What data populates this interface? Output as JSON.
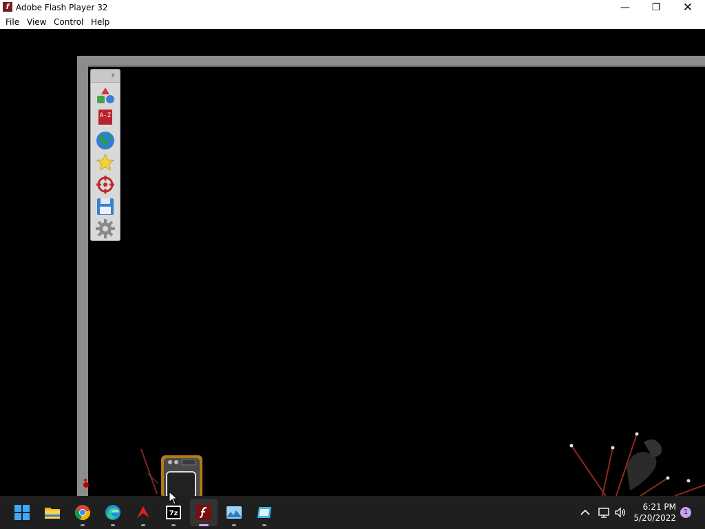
{
  "window": {
    "title": "Adobe Flash Player 32",
    "app_icon_glyph": "f",
    "controls": {
      "minimize": "—",
      "maximize": "❐",
      "close": "✕"
    }
  },
  "menu": {
    "items": [
      "File",
      "View",
      "Control",
      "Help"
    ]
  },
  "toolbar": {
    "collapse_glyph": "›",
    "tools": [
      {
        "name": "shapes-icon"
      },
      {
        "name": "a-z-icon",
        "label": "A-Z"
      },
      {
        "name": "globe-icon"
      },
      {
        "name": "star-icon"
      },
      {
        "name": "target-icon"
      },
      {
        "name": "save-icon"
      },
      {
        "name": "gear-icon"
      }
    ]
  },
  "taskbar": {
    "apps": [
      {
        "name": "start-icon"
      },
      {
        "name": "file-explorer-icon"
      },
      {
        "name": "chrome-icon"
      },
      {
        "name": "edge-icon"
      },
      {
        "name": "acrobat-icon"
      },
      {
        "name": "7zip-icon",
        "label": "7z"
      },
      {
        "name": "flash-player-icon",
        "active": true
      },
      {
        "name": "photos-icon"
      },
      {
        "name": "window-app-icon"
      }
    ],
    "tray": {
      "time": "6:21 PM",
      "date": "5/20/2022",
      "notifications": "1"
    }
  },
  "colors": {
    "stage": "#000000",
    "frame": "#8c8c8c",
    "taskbar": "#1f1f1f",
    "accent": "#d6a9f0"
  }
}
